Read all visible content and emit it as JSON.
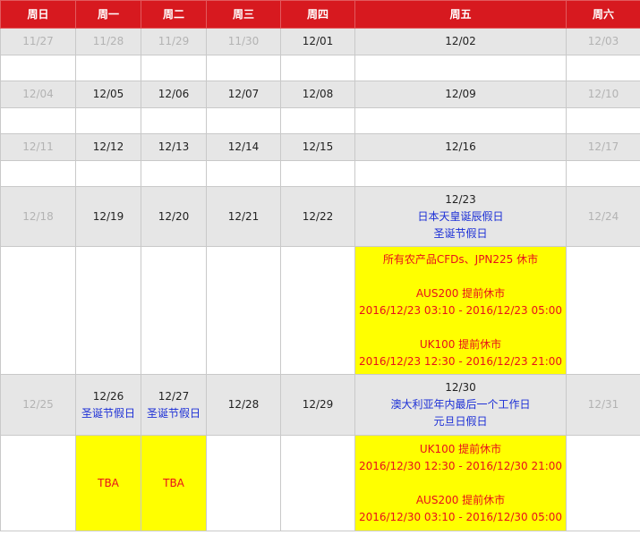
{
  "weekdays": [
    "周日",
    "周一",
    "周二",
    "周三",
    "周四",
    "周五",
    "周六"
  ],
  "week1": {
    "dates": [
      "11/27",
      "11/28",
      "11/29",
      "11/30",
      "12/01",
      "12/02",
      "12/03"
    ]
  },
  "week2": {
    "dates": [
      "12/04",
      "12/05",
      "12/06",
      "12/07",
      "12/08",
      "12/09",
      "12/10"
    ]
  },
  "week3": {
    "dates": [
      "12/11",
      "12/12",
      "12/13",
      "12/14",
      "12/15",
      "12/16",
      "12/17"
    ]
  },
  "week4": {
    "dates": [
      "12/18",
      "12/19",
      "12/20",
      "12/21",
      "12/22",
      "12/23",
      "12/24"
    ],
    "fri_notes": [
      "日本天皇诞辰假日",
      "圣诞节假日"
    ],
    "fri_event": {
      "line1": "所有农产品CFDs、JPN225 休市",
      "line2": "AUS200 提前休市",
      "line3": "2016/12/23 03:10 - 2016/12/23 05:00",
      "line4": "UK100 提前休市",
      "line5": "2016/12/23 12:30 - 2016/12/23 21:00"
    }
  },
  "week5": {
    "dates": [
      "12/25",
      "12/26",
      "12/27",
      "12/28",
      "12/29",
      "12/30",
      "12/31"
    ],
    "mon_note": "圣诞节假日",
    "tue_note": "圣诞节假日",
    "fri_notes": [
      "澳大利亚年内最后一个工作日",
      "元旦日假日"
    ],
    "mon_event": "TBA",
    "tue_event": "TBA",
    "fri_event": {
      "line1": "UK100 提前休市",
      "line2": "2016/12/30 12:30 - 2016/12/30 21:00",
      "line3": "AUS200 提前休市",
      "line4": "2016/12/30 03:10 - 2016/12/30 05:00"
    }
  }
}
